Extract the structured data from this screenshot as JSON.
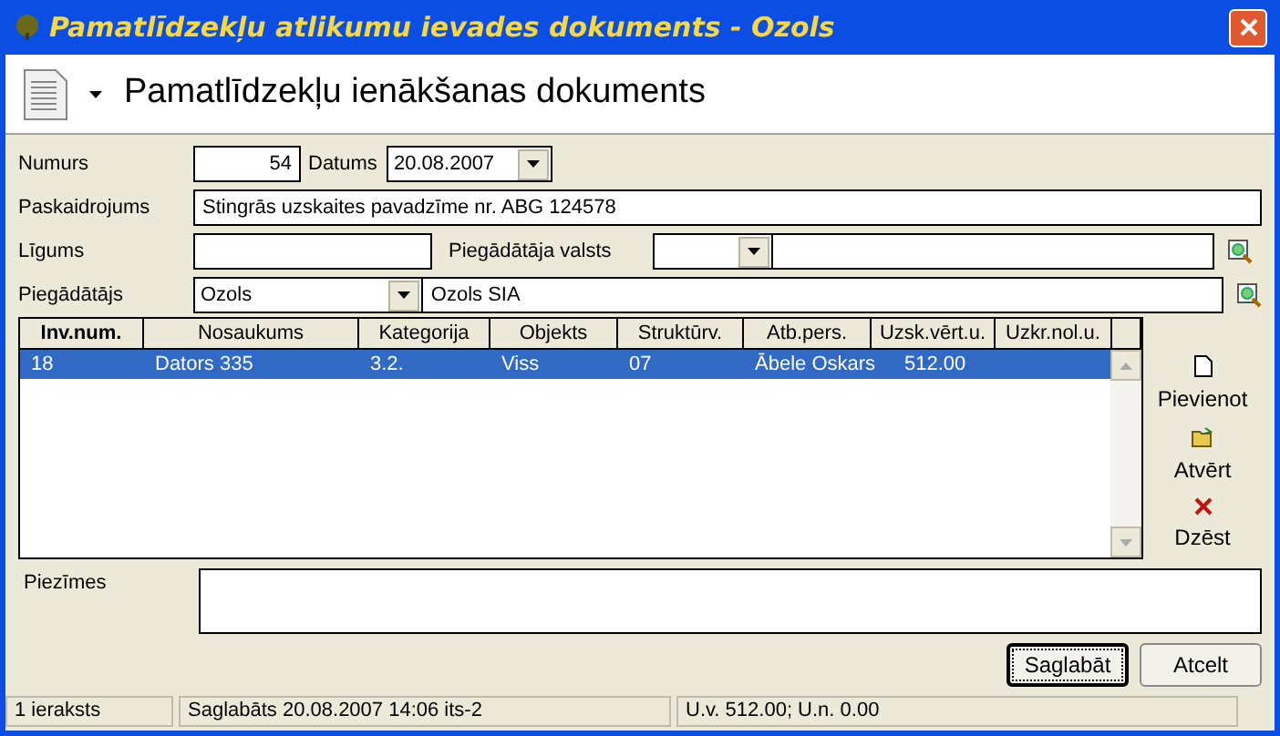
{
  "window": {
    "title": "Pamatlīdzekļu atlikumu ievades dokuments - Ozols"
  },
  "header": {
    "title": "Pamatlīdzekļu ienākšanas dokuments"
  },
  "form": {
    "numurs": {
      "label": "Numurs",
      "value": "54"
    },
    "datums": {
      "label": "Datums",
      "value": "20.08.2007"
    },
    "paskaidrojums": {
      "label": "Paskaidrojums",
      "value": "Stingrās uzskaites pavadzīme nr. ABG 124578"
    },
    "ligums": {
      "label": "Līgums"
    },
    "valsts": {
      "label": "Piegādātāja valsts"
    },
    "piegadatajs": {
      "label": "Piegādātājs",
      "value": "Ozols",
      "name": "Ozols SIA"
    }
  },
  "table": {
    "columns": [
      "Inv.num.",
      "Nosaukums",
      "Kategorija",
      "Objekts",
      "Struktūrv.",
      "Atb.pers.",
      "Uzsk.vērt.u.",
      "Uzkr.nol.u."
    ],
    "rows": [
      {
        "cells": [
          "18",
          "Dators 335",
          "3.2.",
          "Viss",
          "07",
          "Ābele Oskars",
          "512.00"
        ],
        "selected": true
      }
    ]
  },
  "side_buttons": [
    {
      "label": "Pievienot",
      "kind": "add"
    },
    {
      "label": "Atvērt",
      "kind": "open"
    },
    {
      "label": "Dzēst",
      "kind": "delete"
    }
  ],
  "notes": {
    "label": "Piezīmes"
  },
  "buttons": [
    {
      "label": "Saglabāt",
      "selected": true
    },
    {
      "label": "Atcelt",
      "selected": false
    }
  ],
  "status_bar": [
    "1 ieraksts",
    "Saglabāts 20.08.2007 14:06 its-2",
    "U.v. 512.00; U.n. 0.00"
  ]
}
